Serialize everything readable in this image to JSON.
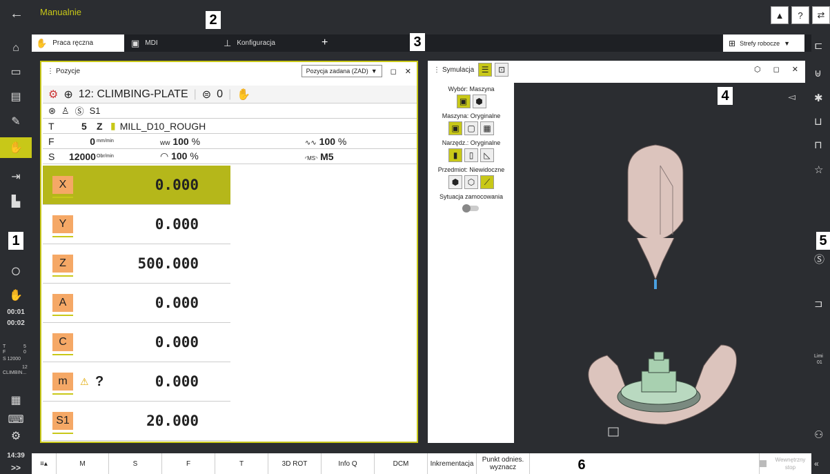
{
  "app": {
    "back_icon": "arrow-left-icon",
    "title": "Manualnie"
  },
  "top_icons": [
    "heidenhain-logo-icon",
    "help-icon",
    "switch-icon"
  ],
  "tabs": [
    {
      "label": "Praca ręczna",
      "icon": "hand-icon",
      "active": true
    },
    {
      "label": "MDI",
      "icon": "mdi-icon",
      "active": false
    },
    {
      "label": "Konfiguracja",
      "icon": "setup-icon",
      "active": false
    }
  ],
  "tab_add": "+",
  "workspace": {
    "label": "Strefy robocze",
    "icon": "grid-icon"
  },
  "callouts": [
    "1",
    "2",
    "3",
    "4",
    "5",
    "6"
  ],
  "left_sidebar": {
    "time1": "00:01",
    "time2": "00:02",
    "status": [
      "T",
      "5",
      "F",
      "0",
      "S 12000",
      "12",
      "CLIMBIN..."
    ],
    "clock": "14:39",
    "expand": ">>"
  },
  "position_panel": {
    "title": "Pozycje",
    "mode_select": "Pozycja zadana (ZAD)",
    "tool_row": {
      "program": "12: CLIMBING-PLATE",
      "preset": "0"
    },
    "spindle_label": "S1",
    "tool": {
      "label": "T",
      "number": "5",
      "axis": "Z",
      "name": "MILL_D10_ROUGH"
    },
    "feed": {
      "label": "F",
      "value": "0",
      "unit": "mm/min",
      "override1": "100",
      "override2": "100",
      "pct": "%"
    },
    "spindle": {
      "label": "S",
      "value": "12000",
      "unit": "Obr/min",
      "override": "100",
      "pct": "%",
      "m": "M5"
    },
    "axes": [
      {
        "label": "X",
        "value": "0.000",
        "active": true
      },
      {
        "label": "Y",
        "value": "0.000",
        "active": false
      },
      {
        "label": "Z",
        "value": "500.000",
        "active": false
      },
      {
        "label": "A",
        "value": "0.000",
        "active": false
      },
      {
        "label": "C",
        "value": "0.000",
        "active": false
      },
      {
        "label": "m",
        "value": "0.000",
        "active": false,
        "warn": "?"
      },
      {
        "label": "S1",
        "value": "20.000",
        "active": false
      }
    ]
  },
  "sim_panel": {
    "title": "Symulacja",
    "selection_label": "Wybór: Maszyna",
    "machine_label": "Maszyna: Oryginalne",
    "tool_label": "Narzędz.: Oryginalne",
    "workpiece_label": "Przedmiot: Niewidoczne",
    "clamp_label": "Sytuacja zamocowania"
  },
  "bottom_bar": {
    "menu": "≡▴",
    "buttons": [
      "M",
      "S",
      "F",
      "T",
      "3D ROT",
      "Info Q",
      "DCM",
      "Inkrementacja",
      "Punkt odnies. wyznacz"
    ],
    "stop_label": "Wewnętrzny stop"
  },
  "right_sidebar": {
    "limit_label": "Limi",
    "limit_value": "01"
  },
  "colors": {
    "accent": "#c8c818",
    "axis_label": "#f5a866",
    "dark": "#2b2d31",
    "machine": "#e0c8c0"
  }
}
